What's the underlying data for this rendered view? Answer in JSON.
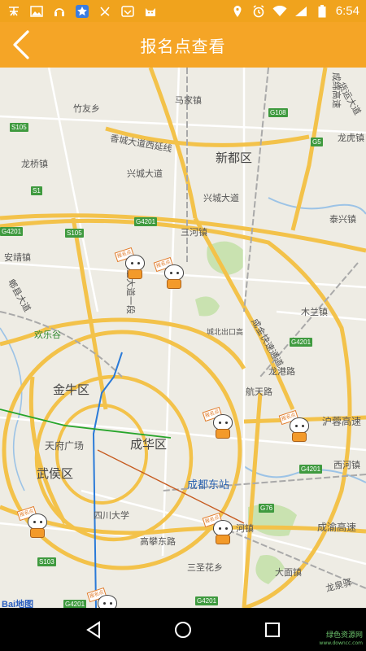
{
  "status_bar": {
    "time": "6:54",
    "left_icons": [
      "payment-icon",
      "image-icon",
      "headset-icon",
      "star-app-icon",
      "download-icon",
      "browser-icon",
      "cat-icon"
    ],
    "right_icons": [
      "location-icon",
      "alarm-icon",
      "wifi-icon",
      "signal-icon",
      "battery-icon"
    ]
  },
  "header": {
    "title": "报名点查看"
  },
  "map": {
    "labels": {
      "zhuyouxiang": "竹友乡",
      "majiazhen": "马家镇",
      "xiangcheng": "香城大道西延线",
      "xinduqu": "新都区",
      "longqiaozhen": "龙桥镇",
      "xingcheng": "兴城大道",
      "xingcheng2": "兴城大道",
      "sanhezhen": "三河镇",
      "anjingzhen": "安靖镇",
      "beixing": "北星大道一段",
      "muyunzhen": "木兰镇",
      "huanlegu": "欢乐谷",
      "longgang": "龙港路",
      "hangguang": "航天路",
      "jinniuqu": "金牛区",
      "tianfu": "天府广场",
      "chenghuaqu": "成华区",
      "wuhouqu": "武侯区",
      "chengdudong": "成都东站",
      "sichuan": "四川大学",
      "gaopan": "高攀东路",
      "sansheng": "三圣花乡",
      "longquan": "龙泉驿",
      "xihezhen": "西河镇",
      "taixingzhen": "泰兴镇",
      "longhu": "龙虎镇",
      "damian": "大面镇",
      "chengyu": "成渝高速",
      "churong": "沪蓉高速",
      "chengmian": "成绵高速",
      "huoyun": "货运大道",
      "chengjin": "成金快速通道",
      "chengdubei": "城北出口高",
      "hehezhen": "河镇",
      "shuangliu": "成都大道",
      "pixiandadao": "郫县大道",
      "baidu_a": "Bai",
      "baidu_b": "地图"
    },
    "shields": [
      "S105",
      "G108",
      "G5",
      "S1",
      "G4201",
      "S105",
      "G4201",
      "G4201",
      "G4201",
      "G76",
      "S103",
      "G4201",
      "G4201"
    ],
    "marker_sign_text": "报名点",
    "markers": [
      "marker-1",
      "marker-2",
      "marker-3",
      "marker-4",
      "marker-5",
      "marker-6",
      "marker-7"
    ]
  },
  "watermark": {
    "line1": "绿色资源网",
    "line2": "www.downcc.com"
  },
  "colors": {
    "accent": "#f5a526",
    "status": "#f0a31d",
    "road_major": "#f5c04a",
    "highway_shield": "#3f9a3f"
  }
}
